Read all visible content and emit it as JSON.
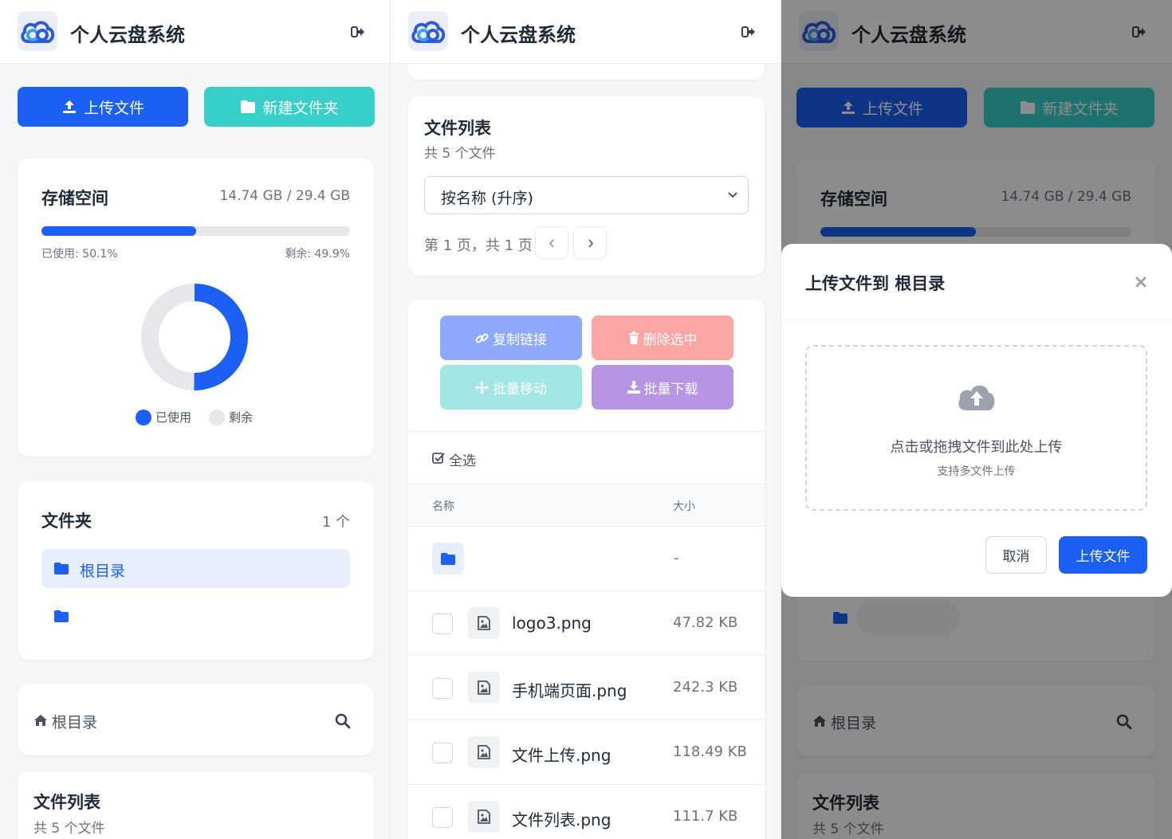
{
  "app": {
    "title": "个人云盘系统"
  },
  "actions": {
    "upload": "上传文件",
    "new_folder": "新建文件夹"
  },
  "storage": {
    "title": "存储空间",
    "usage": "14.74 GB / 29.4 GB",
    "used_label": "已使用: 50.1%",
    "remaining_label": "剩余: 49.9%",
    "used_fraction": 0.501,
    "legend_used": "已使用",
    "legend_remaining": "剩余",
    "colors": {
      "used": "#1b5ff4",
      "remaining": "#e5e7eb"
    }
  },
  "folders": {
    "title": "文件夹",
    "count": "1 个",
    "items": [
      {
        "label": "根目录"
      }
    ]
  },
  "breadcrumb": {
    "label": "根目录"
  },
  "file_list": {
    "title": "文件列表",
    "subtitle": "共 5 个文件",
    "sort_selected": "按名称 (升序)",
    "pagination": "第 1 页，共 1 页",
    "bulk": {
      "copy_link": "复制链接",
      "delete": "删除选中",
      "move": "批量移动",
      "download": "批量下载"
    },
    "select_all": "全选",
    "columns": {
      "name": "名称",
      "size": "大小"
    },
    "folder_row_size": "-",
    "files": [
      {
        "name": "logo3.png",
        "size": "47.82 KB"
      },
      {
        "name": "手机端页面.png",
        "size": "242.3 KB"
      },
      {
        "name": "文件上传.png",
        "size": "118.49 KB"
      },
      {
        "name": "文件列表.png",
        "size": "111.7 KB"
      }
    ]
  },
  "upload_modal": {
    "title": "上传文件到 根目录",
    "drop_text": "点击或拖拽文件到此处上传",
    "drop_hint": "支持多文件上传",
    "cancel": "取消",
    "submit": "上传文件"
  },
  "colors": {
    "primary": "#1b5ff4",
    "teal": "#36cfc9"
  }
}
